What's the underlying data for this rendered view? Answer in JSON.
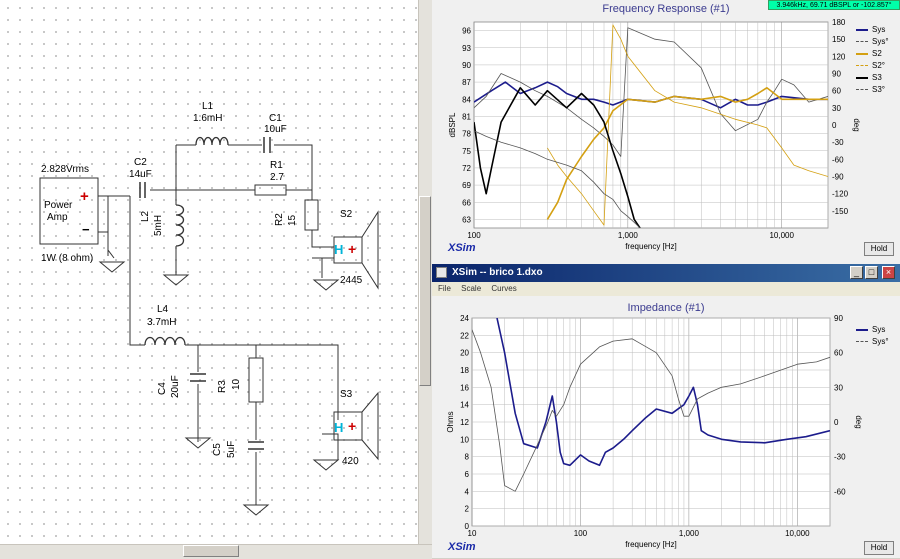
{
  "readout": "3.946kHz, 69.71 dBSPL or -102.857°",
  "schematic": {
    "power_amp": {
      "label_line1": "Power",
      "label_line2": "Amp",
      "voltage": "2.828Vrms",
      "power": "1W (8 ohm)",
      "plus": "+",
      "minus": "−"
    },
    "components": [
      {
        "id": "C2",
        "value": "14uF"
      },
      {
        "id": "L1",
        "value": "1.6mH"
      },
      {
        "id": "C1",
        "value": "10uF"
      },
      {
        "id": "R1",
        "value": "2.7"
      },
      {
        "id": "L2",
        "value": "5mH"
      },
      {
        "id": "R2",
        "value": "15"
      },
      {
        "id": "L4",
        "value": "3.7mH"
      },
      {
        "id": "C4",
        "value": "20uF"
      },
      {
        "id": "R3",
        "value": "10"
      },
      {
        "id": "C5",
        "value": "5uF"
      }
    ],
    "drivers": [
      {
        "id": "S2",
        "number": "2445"
      },
      {
        "id": "S3",
        "number": "420"
      }
    ]
  },
  "freq_panel": {
    "title": "Frequency Response (#1)",
    "brand": "XSim",
    "hold_label": "Hold",
    "legend": [
      {
        "name": "Sys",
        "color": "#1c1c8c",
        "dash": "solid"
      },
      {
        "name": "Sys°",
        "color": "#555555",
        "dash": "dotted"
      },
      {
        "name": "S2",
        "color": "#d4a012",
        "dash": "solid"
      },
      {
        "name": "S2°",
        "color": "#d4a012",
        "dash": "dotted"
      },
      {
        "name": "S3",
        "color": "#000000",
        "dash": "solid"
      },
      {
        "name": "S3°",
        "color": "#555555",
        "dash": "dotted"
      }
    ]
  },
  "imp_window": {
    "title": "XSim -- brico 1.dxo",
    "menu": [
      "File",
      "Scale",
      "Curves"
    ],
    "btn_min": "_",
    "btn_max": "□",
    "btn_close": "×"
  },
  "imp_panel": {
    "title": "Impedance (#1)",
    "brand": "XSim",
    "hold_label": "Hold",
    "legend": [
      {
        "name": "Sys",
        "color": "#1c1c8c",
        "dash": "solid"
      },
      {
        "name": "Sys°",
        "color": "#555555",
        "dash": "dotted"
      }
    ]
  },
  "chart_data": [
    {
      "type": "line",
      "title": "Frequency Response (#1)",
      "xlabel": "frequency [Hz]",
      "ylabel": "dBSPL",
      "y2label": "deg",
      "xscale": "log",
      "xlim": [
        100,
        20000
      ],
      "ylim": [
        61.5,
        97.5
      ],
      "y2lim": [
        -180,
        180
      ],
      "xticks": [
        100,
        1000,
        10000
      ],
      "xtick_labels": [
        "100",
        "1,000",
        "10,000"
      ],
      "yticks": [
        63,
        66,
        69,
        72,
        75,
        78,
        81,
        84,
        87,
        90,
        93,
        96
      ],
      "y2ticks": [
        -150,
        -120,
        -90,
        -60,
        -30,
        0,
        30,
        60,
        90,
        120,
        150,
        180
      ],
      "grid": true,
      "legend_position": "top-right",
      "series": [
        {
          "name": "Sys",
          "axis": "left",
          "x": [
            100,
            130,
            160,
            200,
            250,
            300,
            350,
            400,
            500,
            600,
            700,
            800,
            1000,
            1500,
            2000,
            3000,
            4000,
            5000,
            6000,
            7000,
            8000,
            10000,
            15000,
            20000
          ],
          "y": [
            83.5,
            85.5,
            87,
            85,
            86,
            87,
            86.2,
            85,
            84,
            84,
            83.5,
            83,
            84,
            83.5,
            84.5,
            84,
            82.5,
            84,
            83,
            83,
            83.5,
            84.5,
            84,
            84
          ]
        },
        {
          "name": "Sys°",
          "axis": "right",
          "x": [
            100,
            120,
            150,
            200,
            250,
            300,
            400,
            500,
            600,
            700,
            800,
            900,
            1000,
            1500,
            2000,
            3000,
            4000,
            5000,
            7000,
            8000,
            9000,
            10000,
            12000,
            15000,
            20000
          ],
          "y": [
            30,
            50,
            90,
            75,
            60,
            50,
            30,
            10,
            -5,
            -20,
            -35,
            -55,
            170,
            150,
            145,
            100,
            20,
            -10,
            10,
            40,
            60,
            80,
            70,
            40,
            50
          ]
        },
        {
          "name": "S2",
          "axis": "left",
          "x": [
            300,
            350,
            400,
            500,
            600,
            700,
            800,
            1000,
            1500,
            2000,
            3000,
            4000,
            5000,
            6000,
            7000,
            8000,
            10000,
            15000,
            20000
          ],
          "y": [
            63,
            66,
            70,
            74,
            77,
            79,
            82,
            84,
            83.5,
            84.5,
            84,
            84.5,
            83.5,
            84,
            85,
            86,
            84,
            84,
            84
          ]
        },
        {
          "name": "S2°",
          "axis": "right",
          "x": [
            300,
            350,
            400,
            500,
            600,
            700,
            800,
            900,
            1000,
            1500,
            2000,
            3000,
            5000,
            7000,
            8000,
            10000,
            12000,
            15000,
            20000
          ],
          "y": [
            -40,
            -70,
            -90,
            -120,
            -150,
            -175,
            175,
            150,
            120,
            60,
            40,
            30,
            10,
            0,
            -5,
            -40,
            -70,
            -80,
            -90
          ]
        },
        {
          "name": "S3",
          "axis": "left",
          "x": [
            100,
            110,
            120,
            130,
            150,
            200,
            250,
            300,
            400,
            500,
            600,
            700,
            800,
            900,
            1000,
            1100,
            1200
          ],
          "y": [
            80,
            72,
            67.5,
            72,
            80,
            86,
            83,
            85.5,
            82.5,
            85,
            83,
            80,
            75,
            71,
            67,
            63,
            61.5
          ]
        },
        {
          "name": "S3°",
          "axis": "right",
          "x": [
            100,
            120,
            150,
            200,
            250,
            300,
            400,
            500,
            600,
            700,
            800,
            900,
            1000,
            1100,
            1200
          ],
          "y": [
            -10,
            -20,
            -30,
            -40,
            -50,
            -60,
            -70,
            -80,
            -100,
            -120,
            -130,
            -150,
            -160,
            -170,
            -180
          ]
        }
      ]
    },
    {
      "type": "line",
      "title": "Impedance (#1)",
      "xlabel": "frequency [Hz]",
      "ylabel": "Ohms",
      "y2label": "deg",
      "xscale": "log",
      "xlim": [
        10,
        20000
      ],
      "ylim": [
        0,
        24
      ],
      "y2lim": [
        -90,
        90
      ],
      "xticks": [
        10,
        100,
        1000,
        10000
      ],
      "xtick_labels": [
        "10",
        "100",
        "1,000",
        "10,000"
      ],
      "yticks": [
        0,
        2,
        4,
        6,
        8,
        10,
        12,
        14,
        16,
        18,
        20,
        22,
        24
      ],
      "y2ticks": [
        -60,
        -30,
        0,
        30,
        60,
        90
      ],
      "grid": true,
      "legend_position": "top-right",
      "series": [
        {
          "name": "Sys",
          "axis": "left",
          "x": [
            17,
            20,
            25,
            30,
            40,
            48,
            55,
            60,
            65,
            70,
            80,
            100,
            120,
            150,
            170,
            200,
            250,
            300,
            400,
            500,
            700,
            900,
            1000,
            1100,
            1200,
            1300,
            1500,
            2000,
            3000,
            5000,
            8000,
            12000,
            20000
          ],
          "y": [
            24,
            20,
            13,
            9.5,
            9,
            12,
            15,
            12,
            8.5,
            7.2,
            7,
            8.2,
            7.5,
            7,
            8.5,
            9,
            10,
            11,
            12.5,
            13.5,
            13,
            14,
            15,
            16,
            14,
            11,
            10.5,
            10,
            9.7,
            9.6,
            10,
            10.3,
            11
          ]
        },
        {
          "name": "Sys°",
          "axis": "right",
          "x": [
            10,
            12,
            15,
            18,
            20,
            25,
            30,
            40,
            50,
            55,
            60,
            70,
            80,
            100,
            150,
            200,
            300,
            500,
            700,
            800,
            900,
            1000,
            1200,
            1500,
            2000,
            3000,
            5000,
            10000,
            15000,
            20000
          ],
          "y": [
            80,
            60,
            30,
            -20,
            -55,
            -60,
            -45,
            -20,
            0,
            10,
            5,
            15,
            30,
            50,
            65,
            70,
            72,
            60,
            40,
            20,
            5,
            5,
            20,
            25,
            30,
            33,
            40,
            50,
            52,
            56
          ]
        }
      ]
    }
  ]
}
